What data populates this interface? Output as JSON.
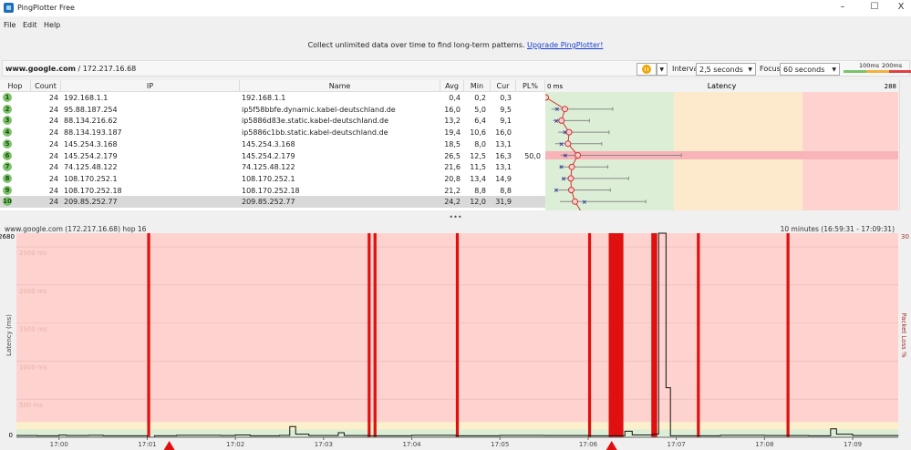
{
  "window": {
    "title": "PingPlotter Free",
    "controls": [
      "–",
      "☐",
      "X"
    ]
  },
  "menu": [
    "File",
    "Edit",
    "Help"
  ],
  "banner": {
    "text": "Collect unlimited data over time to find long-term patterns.",
    "link": "Upgrade PingPlotter!"
  },
  "target": {
    "host": "www.google.com",
    "ip": " / 172.217.16.68"
  },
  "toolbar": {
    "pause_icon": "pause-icon",
    "interval_label": "Interval",
    "interval_value": "2,5 seconds",
    "focus_label": "Focus",
    "focus_value": "60 seconds",
    "scale_100": "100ms",
    "scale_200": "200ms"
  },
  "table": {
    "headers": [
      "Hop",
      "Count",
      "IP",
      "Name",
      "Avg",
      "Min",
      "Cur",
      "PL%"
    ],
    "rows": [
      {
        "hop": "1",
        "count": "24",
        "ip": "192.168.1.1",
        "name": "192.168.1.1",
        "avg": "0,4",
        "min": "0,2",
        "cur": "0,3",
        "pl": "",
        "max": 1
      },
      {
        "hop": "2",
        "count": "24",
        "ip": "95.88.187.254",
        "name": "ip5f58bbfe.dynamic.kabel-deutschland.de",
        "avg": "16,0",
        "min": "5,0",
        "cur": "9,5",
        "pl": "",
        "max": 55
      },
      {
        "hop": "3",
        "count": "24",
        "ip": "88.134.216.62",
        "name": "ip5886d83e.static.kabel-deutschland.de",
        "avg": "13,2",
        "min": "6,4",
        "cur": "9,1",
        "pl": "",
        "max": 36
      },
      {
        "hop": "4",
        "count": "24",
        "ip": "88.134.193.187",
        "name": "ip5886c1bb.static.kabel-deutschland.de",
        "avg": "19,4",
        "min": "10,6",
        "cur": "16,0",
        "pl": "",
        "max": 52
      },
      {
        "hop": "5",
        "count": "24",
        "ip": "145.254.3.168",
        "name": "145.254.3.168",
        "avg": "18,5",
        "min": "8,0",
        "cur": "13,1",
        "pl": "",
        "max": 46
      },
      {
        "hop": "6",
        "count": "24",
        "ip": "145.254.2.179",
        "name": "145.254.2.179",
        "avg": "26,5",
        "min": "12,5",
        "cur": "16,3",
        "pl": "50,0",
        "max": 111
      },
      {
        "hop": "7",
        "count": "24",
        "ip": "74.125.48.122",
        "name": "74.125.48.122",
        "avg": "21,6",
        "min": "11,5",
        "cur": "13,1",
        "pl": "",
        "max": 51
      },
      {
        "hop": "8",
        "count": "24",
        "ip": "108.170.252.1",
        "name": "108.170.252.1",
        "avg": "20,8",
        "min": "13,4",
        "cur": "14,9",
        "pl": "",
        "max": 68
      },
      {
        "hop": "9",
        "count": "24",
        "ip": "108.170.252.18",
        "name": "108.170.252.18",
        "avg": "21,2",
        "min": "8,8",
        "cur": "8,8",
        "pl": "",
        "max": 53
      },
      {
        "hop": "10",
        "count": "24",
        "ip": "209.85.252.77",
        "name": "209.85.252.77",
        "avg": "24,2",
        "min": "12,0",
        "cur": "31,9",
        "pl": "",
        "max": 82
      }
    ]
  },
  "latency_chart": {
    "left_label": "0 ms",
    "title": "Latency",
    "right_label": "288",
    "max_ms": 288,
    "zones": {
      "green_to": 100,
      "yellow_to": 200
    },
    "colors": {
      "green": "#dcefd6",
      "yellow": "#fde9cc",
      "red": "#fdd2cf",
      "loss_row": "#f8b4b8"
    }
  },
  "chart_data": {
    "type": "line",
    "title": "www.google.com (172.217.16.68) hop 16",
    "range_label": "10 minutes (16:59:31 - 17:09:31)",
    "ylabel": "Latency (ms)",
    "y2label": "Packet Loss %",
    "ylim": [
      0,
      2680
    ],
    "y2lim": [
      0,
      30
    ],
    "y_top_label": "2680",
    "y_zero_label": "0",
    "y2_top_label": "30",
    "y_gridlines": [
      "500 ms",
      "1000 ms",
      "1500 ms",
      "2000 ms",
      "2500 ms"
    ],
    "xlim": [
      "16:59:31",
      "17:09:31"
    ],
    "x_ticks": [
      "17:00",
      "17:01",
      "17:02",
      "17:03",
      "17:04",
      "17:05",
      "17:06",
      "17:07",
      "17:08",
      "17:09"
    ],
    "zones": {
      "green_to": 100,
      "yellow_to": 200
    },
    "latency": [
      [
        "16:59:31",
        22
      ],
      [
        "16:59:45",
        20
      ],
      [
        "17:00:00",
        28
      ],
      [
        "17:00:05",
        22
      ],
      [
        "17:00:20",
        26
      ],
      [
        "17:00:30",
        20
      ],
      [
        "17:01:00",
        0
      ],
      [
        "17:01:05",
        20
      ],
      [
        "17:01:20",
        25
      ],
      [
        "17:01:50",
        22
      ],
      [
        "17:02:00",
        30
      ],
      [
        "17:02:10",
        20
      ],
      [
        "17:02:30",
        24
      ],
      [
        "17:02:37",
        140
      ],
      [
        "17:02:41",
        40
      ],
      [
        "17:02:50",
        22
      ],
      [
        "17:03:10",
        60
      ],
      [
        "17:03:14",
        22
      ],
      [
        "17:03:30",
        20
      ],
      [
        "17:04:00",
        26
      ],
      [
        "17:04:30",
        20
      ],
      [
        "17:05:00",
        24
      ],
      [
        "17:05:30",
        22
      ],
      [
        "17:06:00",
        20
      ],
      [
        "17:06:25",
        80
      ],
      [
        "17:06:30",
        30
      ],
      [
        "17:06:44",
        40
      ],
      [
        "17:06:48",
        2680
      ],
      [
        "17:06:53",
        650
      ],
      [
        "17:06:56",
        20
      ],
      [
        "17:07:30",
        25
      ],
      [
        "17:08:00",
        22
      ],
      [
        "17:08:30",
        20
      ],
      [
        "17:08:45",
        110
      ],
      [
        "17:08:49",
        40
      ],
      [
        "17:09:00",
        22
      ],
      [
        "17:09:31",
        25
      ]
    ],
    "packet_loss_events": [
      [
        "17:01:00",
        "17:01:02"
      ],
      [
        "17:03:30",
        "17:03:32"
      ],
      [
        "17:03:34",
        "17:03:36"
      ],
      [
        "17:04:30",
        "17:04:32"
      ],
      [
        "17:06:00",
        "17:06:02"
      ],
      [
        "17:06:14",
        "17:06:24"
      ],
      [
        "17:06:43",
        "17:06:47"
      ],
      [
        "17:07:14",
        "17:07:16"
      ],
      [
        "17:08:15",
        "17:08:17"
      ]
    ],
    "event_markers": [
      "17:01:15",
      "17:06:16"
    ],
    "colors": {
      "loss": "#e01010",
      "red_zone": "#fdd2cf",
      "yellow_zone": "#fbf0cc",
      "green_zone": "#dcefd6",
      "line": "#111111",
      "marker": "#e01010"
    }
  }
}
